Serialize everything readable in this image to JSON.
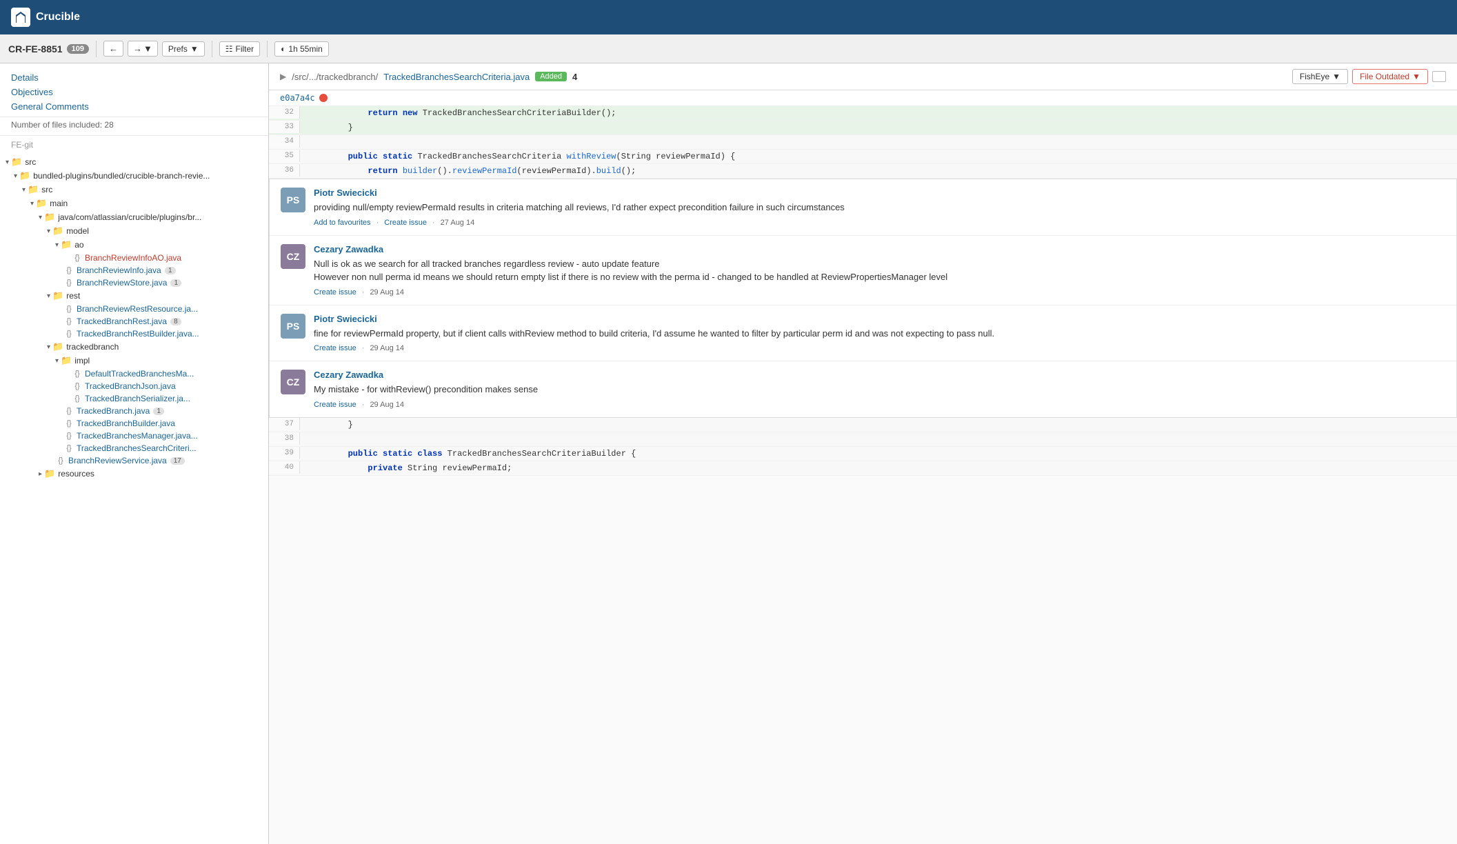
{
  "app": {
    "name": "Crucible",
    "logo_text": "Crucible"
  },
  "review": {
    "id": "CR-FE-8851",
    "comment_count": "109"
  },
  "toolbar": {
    "prefs_label": "Prefs",
    "filter_label": "Filter",
    "time_label": "1h 55min"
  },
  "sidebar": {
    "nav_items": [
      {
        "label": "Details",
        "href": "#"
      },
      {
        "label": "Objectives",
        "href": "#"
      },
      {
        "label": "General Comments",
        "href": "#"
      }
    ],
    "file_count_label": "Number of files included: 28",
    "repo_label": "FE-git",
    "tree": [
      {
        "indent": 0,
        "type": "folder",
        "name": "src",
        "expanded": true
      },
      {
        "indent": 1,
        "type": "folder",
        "name": "bundled-plugins/bundled/crucible-branch-revie...",
        "expanded": true
      },
      {
        "indent": 2,
        "type": "folder",
        "name": "src",
        "expanded": true
      },
      {
        "indent": 3,
        "type": "folder",
        "name": "main",
        "expanded": true
      },
      {
        "indent": 4,
        "type": "folder",
        "name": "java/com/atlassian/crucible/plugins/br...",
        "expanded": true
      },
      {
        "indent": 5,
        "type": "folder",
        "name": "model",
        "expanded": true
      },
      {
        "indent": 6,
        "type": "folder",
        "name": "ao",
        "expanded": true
      },
      {
        "indent": 7,
        "type": "file",
        "name": "BranchReviewInfoAO.java",
        "color": "red",
        "badge": null
      },
      {
        "indent": 6,
        "type": "file",
        "name": "BranchReviewInfo.java",
        "color": "blue",
        "badge": "1"
      },
      {
        "indent": 6,
        "type": "file",
        "name": "BranchReviewStore.java",
        "color": "blue",
        "badge": "1"
      },
      {
        "indent": 5,
        "type": "folder",
        "name": "rest",
        "expanded": true
      },
      {
        "indent": 6,
        "type": "file",
        "name": "BranchReviewRestResource.ja...",
        "color": "blue",
        "badge": null
      },
      {
        "indent": 6,
        "type": "file",
        "name": "TrackedBranchRest.java",
        "color": "blue",
        "badge": "8"
      },
      {
        "indent": 6,
        "type": "file",
        "name": "TrackedBranchRestBuilder.java...",
        "color": "blue",
        "badge": null
      },
      {
        "indent": 5,
        "type": "folder",
        "name": "trackedbranch",
        "expanded": true
      },
      {
        "indent": 6,
        "type": "folder",
        "name": "impl",
        "expanded": true
      },
      {
        "indent": 7,
        "type": "file",
        "name": "DefaultTrackedBranchesMa...",
        "color": "blue",
        "badge": null
      },
      {
        "indent": 7,
        "type": "file",
        "name": "TrackedBranchJson.java",
        "color": "blue",
        "badge": null
      },
      {
        "indent": 7,
        "type": "file",
        "name": "TrackedBranchSerializer.ja...",
        "color": "blue",
        "badge": null
      },
      {
        "indent": 6,
        "type": "file",
        "name": "TrackedBranch.java",
        "color": "blue",
        "badge": "1"
      },
      {
        "indent": 6,
        "type": "file",
        "name": "TrackedBranchBuilder.java",
        "color": "blue",
        "badge": null
      },
      {
        "indent": 6,
        "type": "file",
        "name": "TrackedBranchesManager.java...",
        "color": "blue",
        "badge": null
      },
      {
        "indent": 6,
        "type": "file",
        "name": "TrackedBranchesSearchCriteri...",
        "color": "blue",
        "badge": null
      },
      {
        "indent": 5,
        "type": "file",
        "name": "BranchReviewService.java",
        "color": "blue",
        "badge": "17"
      },
      {
        "indent": 4,
        "type": "folder",
        "name": "resources",
        "expanded": false
      }
    ]
  },
  "file_view": {
    "path_prefix": "/src/.../trackedbranch/",
    "file_name": "TrackedBranchesSearchCriteria.java",
    "status": "Added",
    "comment_count": "4",
    "fisheye_label": "FishEye",
    "file_outdated_label": "File Outdated",
    "commit_hash": "e0a7a4c",
    "code_lines": [
      {
        "num": "32",
        "highlighted": true,
        "content": "            return new TrackedBranchesSearchCriteriaBuilder();"
      },
      {
        "num": "33",
        "highlighted": true,
        "content": "        }"
      },
      {
        "num": "34",
        "highlighted": false,
        "content": ""
      },
      {
        "num": "35",
        "highlighted": false,
        "content": "        public static TrackedBranchesSearchCriteria withReview(String reviewPermaId) {"
      },
      {
        "num": "36",
        "highlighted": false,
        "content": "            return builder().reviewPermaId(reviewPermaId).build();"
      }
    ],
    "code_lines_bottom": [
      {
        "num": "37",
        "highlighted": false,
        "content": "        }"
      },
      {
        "num": "38",
        "highlighted": false,
        "content": ""
      },
      {
        "num": "39",
        "highlighted": false,
        "content": "        public static class TrackedBranchesSearchCriteriaBuilder {"
      },
      {
        "num": "40",
        "highlighted": false,
        "content": "            private String reviewPermaId;"
      }
    ]
  },
  "comments": [
    {
      "id": "c1",
      "author": "Piotr Swiecicki",
      "avatar_initials": "PS",
      "avatar_class": "avatar-ps",
      "text": "providing null/empty reviewPermaId results in criteria matching all reviews, I'd rather expect precondition failure in such circumstances",
      "actions": [
        "Add to favourites",
        "Create issue"
      ],
      "date": "27 Aug 14"
    },
    {
      "id": "c2",
      "author": "Cezary Zawadka",
      "avatar_initials": "CZ",
      "avatar_class": "avatar-cz",
      "text": "Null is ok as we search for all tracked branches regardless review - auto update feature\nHowever non null perma id means we should return empty list if there is no review with the perma id - changed to be handled at ReviewPropertiesManager level",
      "actions": [
        "Create issue"
      ],
      "date": "29 Aug 14"
    },
    {
      "id": "c3",
      "author": "Piotr Swiecicki",
      "avatar_initials": "PS",
      "avatar_class": "avatar-ps",
      "text": "fine for reviewPermaId property, but if client calls withReview method to build criteria, I'd assume he wanted to filter by particular perm id and was not expecting to pass null.",
      "actions": [
        "Create issue"
      ],
      "date": "29 Aug 14"
    },
    {
      "id": "c4",
      "author": "Cezary Zawadka",
      "avatar_initials": "CZ",
      "avatar_class": "avatar-cz",
      "text": "My mistake - for withReview() precondition makes sense",
      "actions": [
        "Create issue"
      ],
      "date": "29 Aug 14"
    }
  ]
}
